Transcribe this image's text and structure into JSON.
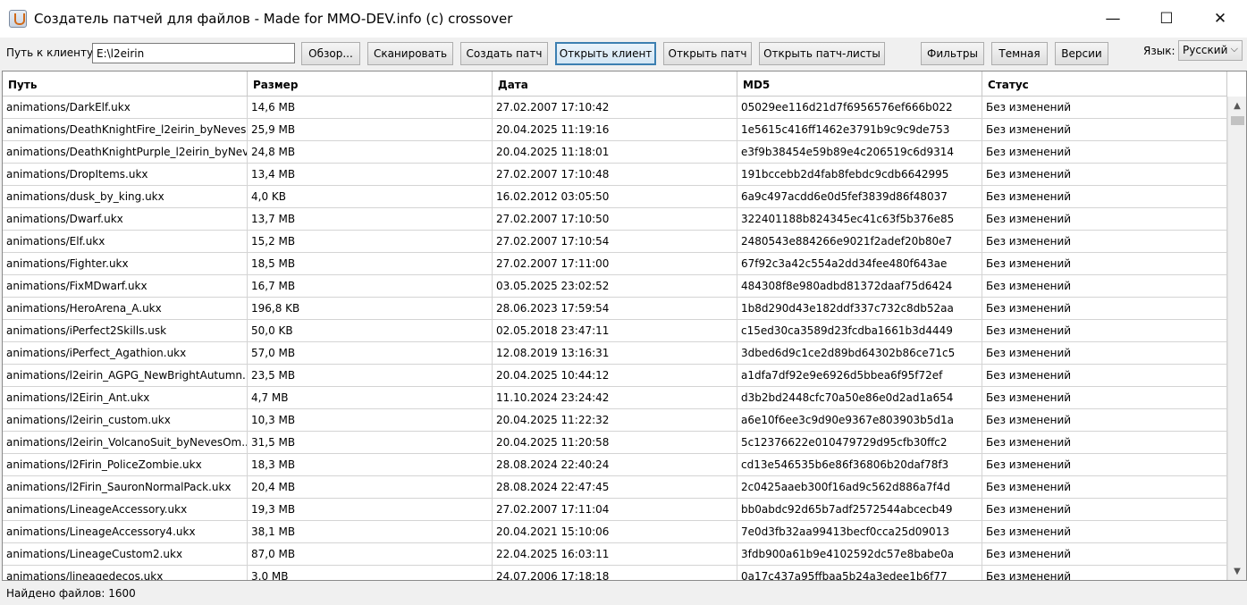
{
  "window": {
    "title": "Создатель патчей для файлов - Made for MMO-DEV.info (c) crossover",
    "minimize": "—",
    "maximize": "☐",
    "close": "✕"
  },
  "toolbar": {
    "path_label": "Путь к клиенту:",
    "path_value": "E:\\l2eirin",
    "browse": "Обзор...",
    "scan": "Сканировать",
    "create_patch": "Создать патч",
    "open_client": "Открыть клиент",
    "open_patch": "Открыть патч",
    "open_patch_lists": "Открыть патч-листы",
    "filters": "Фильтры",
    "dark": "Темная",
    "versions": "Версии",
    "language_label": "Язык:",
    "language_value": "Русский"
  },
  "table": {
    "columns": [
      "Путь",
      "Размер",
      "Дата",
      "MD5",
      "Статус"
    ],
    "rows": [
      [
        "animations/DarkElf.ukx",
        "14,6 MB",
        "27.02.2007 17:10:42",
        "05029ee116d21d7f6956576ef666b022",
        "Без изменений"
      ],
      [
        "animations/DeathKnightFire_l2eirin_byNeves...",
        "25,9 MB",
        "20.04.2025 11:19:16",
        "1e5615c416ff1462e3791b9c9c9de753",
        "Без изменений"
      ],
      [
        "animations/DeathKnightPurple_l2eirin_byNev...",
        "24,8 MB",
        "20.04.2025 11:18:01",
        "e3f9b38454e59b89e4c206519c6d9314",
        "Без изменений"
      ],
      [
        "animations/DropItems.ukx",
        "13,4 MB",
        "27.02.2007 17:10:48",
        "191bccebb2d4fab8febdc9cdb6642995",
        "Без изменений"
      ],
      [
        "animations/dusk_by_king.ukx",
        "4,0 KB",
        "16.02.2012 03:05:50",
        "6a9c497acdd6e0d5fef3839d86f48037",
        "Без изменений"
      ],
      [
        "animations/Dwarf.ukx",
        "13,7 MB",
        "27.02.2007 17:10:50",
        "322401188b824345ec41c63f5b376e85",
        "Без изменений"
      ],
      [
        "animations/Elf.ukx",
        "15,2 MB",
        "27.02.2007 17:10:54",
        "2480543e884266e9021f2adef20b80e7",
        "Без изменений"
      ],
      [
        "animations/Fighter.ukx",
        "18,5 MB",
        "27.02.2007 17:11:00",
        "67f92c3a42c554a2dd34fee480f643ae",
        "Без изменений"
      ],
      [
        "animations/FixMDwarf.ukx",
        "16,7 MB",
        "03.05.2025 23:02:52",
        "484308f8e980adbd81372daaf75d6424",
        "Без изменений"
      ],
      [
        "animations/HeroArena_A.ukx",
        "196,8 KB",
        "28.06.2023 17:59:54",
        "1b8d290d43e182ddf337c732c8db52aa",
        "Без изменений"
      ],
      [
        "animations/iPerfect2Skills.usk",
        "50,0 KB",
        "02.05.2018 23:47:11",
        "c15ed30ca3589d23fcdba1661b3d4449",
        "Без изменений"
      ],
      [
        "animations/iPerfect_Agathion.ukx",
        "57,0 MB",
        "12.08.2019 13:16:31",
        "3dbed6d9c1ce2d89bd64302b86ce71c5",
        "Без изменений"
      ],
      [
        "animations/l2eirin_AGPG_NewBrightAutumn...",
        "23,5 MB",
        "20.04.2025 10:44:12",
        "a1dfa7df92e9e6926d5bbea6f95f72ef",
        "Без изменений"
      ],
      [
        "animations/l2Eirin_Ant.ukx",
        "4,7 MB",
        "11.10.2024 23:24:42",
        "d3b2bd2448cfc70a50e86e0d2ad1a654",
        "Без изменений"
      ],
      [
        "animations/l2eirin_custom.ukx",
        "10,3 MB",
        "20.04.2025 11:22:32",
        "a6e10f6ee3c9d90e9367e803903b5d1a",
        "Без изменений"
      ],
      [
        "animations/l2eirin_VolcanoSuit_byNevesOm...",
        "31,5 MB",
        "20.04.2025 11:20:58",
        "5c12376622e010479729d95cfb30ffc2",
        "Без изменений"
      ],
      [
        "animations/l2Firin_PoliceZombie.ukx",
        "18,3 MB",
        "28.08.2024 22:40:24",
        "cd13e546535b6e86f36806b20daf78f3",
        "Без изменений"
      ],
      [
        "animations/l2Firin_SauronNormalPack.ukx",
        "20,4 MB",
        "28.08.2024 22:47:45",
        "2c0425aaeb300f16ad9c562d886a7f4d",
        "Без изменений"
      ],
      [
        "animations/LineageAccessory.ukx",
        "19,3 MB",
        "27.02.2007 17:11:04",
        "bb0abdc92d65b7adf2572544abcecb49",
        "Без изменений"
      ],
      [
        "animations/LineageAccessory4.ukx",
        "38,1 MB",
        "20.04.2021 15:10:06",
        "7e0d3fb32aa99413becf0cca25d09013",
        "Без изменений"
      ],
      [
        "animations/LineageCustom2.ukx",
        "87,0 MB",
        "22.04.2025 16:03:11",
        "3fdb900a61b9e4102592dc57e8babe0a",
        "Без изменений"
      ],
      [
        "animations/lineagedecos.ukx",
        "3,0 MB",
        "24.07.2006 17:18:18",
        "0a17c437a95ffbaa5b24a3edee1b6f77",
        "Без изменений"
      ]
    ]
  },
  "scrollbar": {
    "up": "▲",
    "down": "▼"
  },
  "status": {
    "found_files": "Найдено файлов: 1600"
  }
}
